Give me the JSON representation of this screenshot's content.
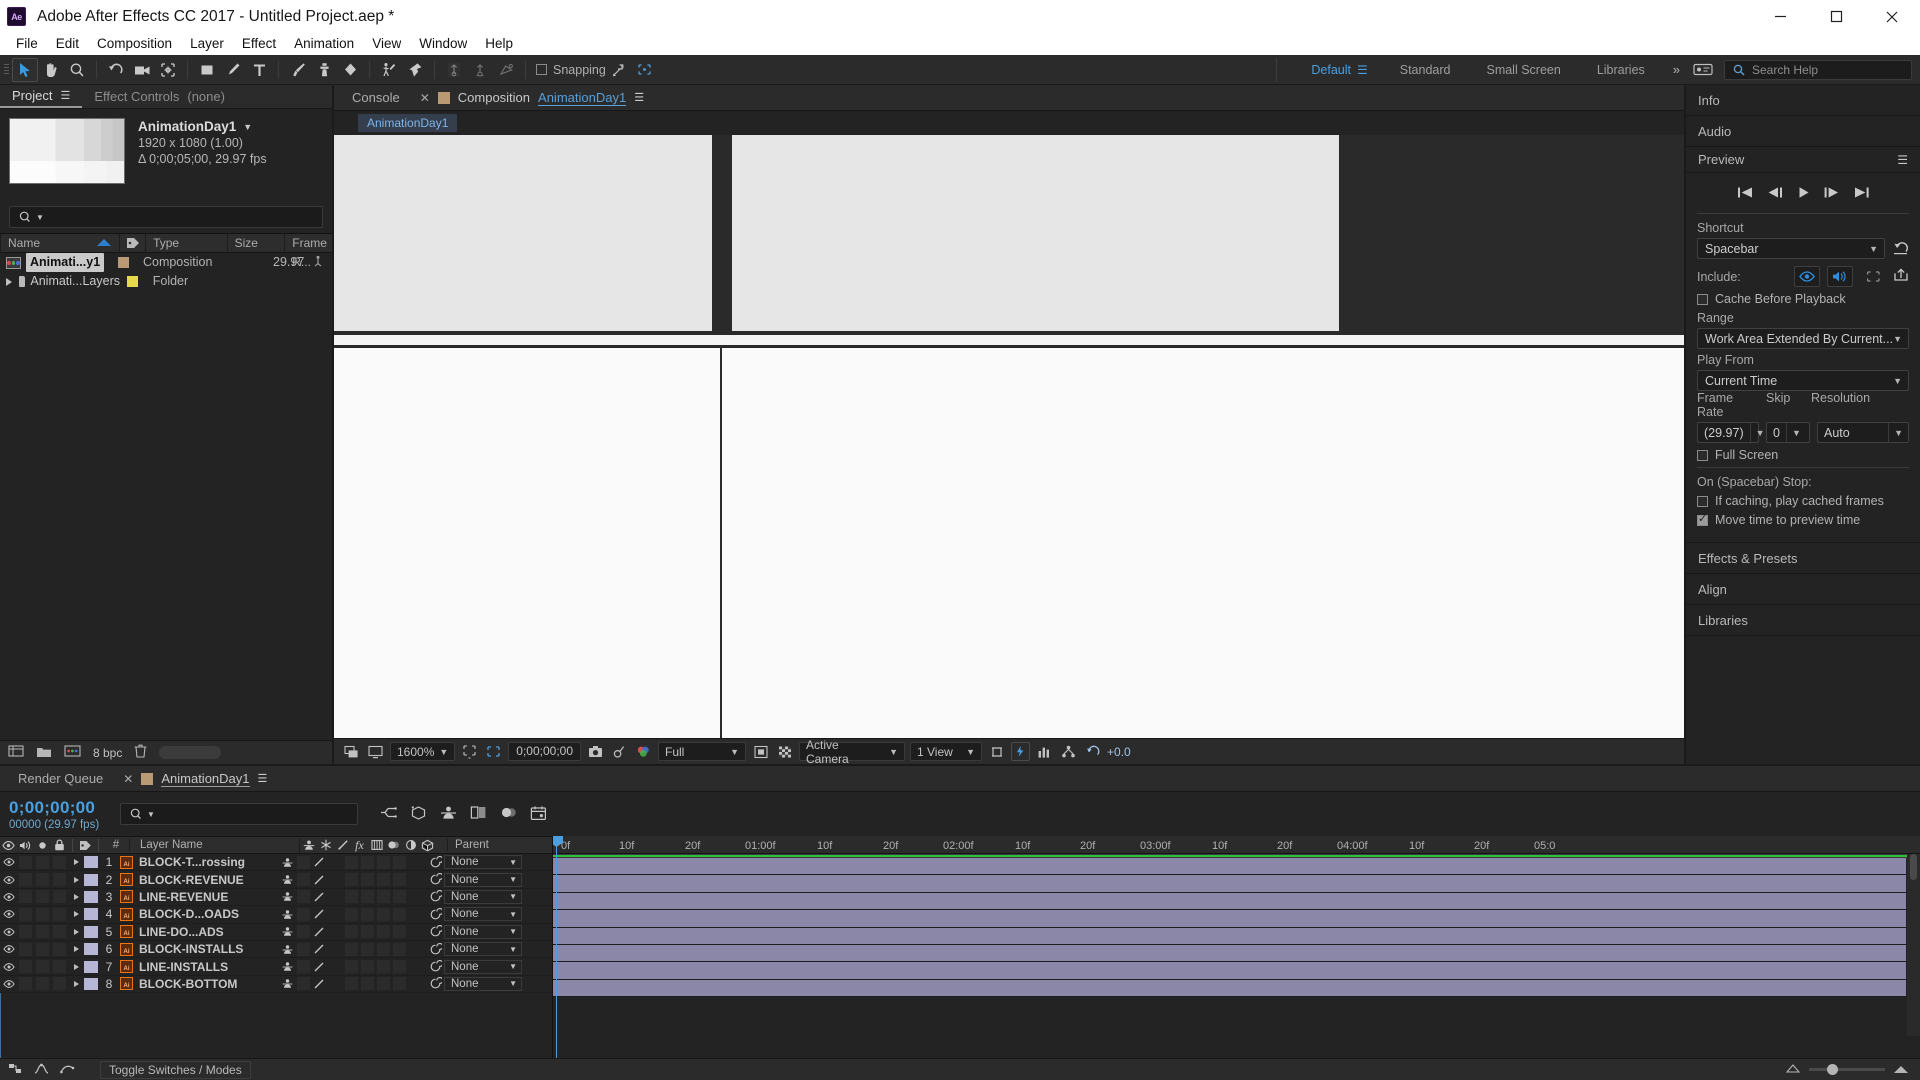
{
  "window": {
    "app_badge": "Ae",
    "title": "Adobe After Effects CC 2017 - Untitled Project.aep *",
    "controls": {
      "minimize": "—",
      "maximize": "❐",
      "close": "✕"
    }
  },
  "menubar": {
    "items": [
      "File",
      "Edit",
      "Composition",
      "Layer",
      "Effect",
      "Animation",
      "View",
      "Window",
      "Help"
    ]
  },
  "toolbar": {
    "snapping_label": "Snapping",
    "snapping_checked": false,
    "workspaces": [
      "Default",
      "Standard",
      "Small Screen",
      "Libraries"
    ],
    "workspace_selected": "Default",
    "overflow_label": "»",
    "search_help_placeholder": "Search Help",
    "search_help_value": "Search Help"
  },
  "project_panel": {
    "tabs": [
      {
        "label": "Project",
        "active": true,
        "has_menu": true
      },
      {
        "label": "Effect Controls",
        "suffix": "(none)",
        "active": false
      }
    ],
    "selected_item": {
      "name": "AnimationDay1",
      "dimensions": "1920 x 1080 (1.00)",
      "duration": "Δ 0;00;05;00, 29.97 fps"
    },
    "search_placeholder": "",
    "columns": [
      "Name",
      "",
      "Type",
      "Size",
      "Frame R..."
    ],
    "rows": [
      {
        "name": "Animati...y1",
        "type": "Composition",
        "size": "",
        "frame_rate": "29.97",
        "selected": true,
        "icon": "composition-icon",
        "swatch": "#b99a74",
        "expandable": false
      },
      {
        "name": "Animati...Layers",
        "type": "Folder",
        "size": "",
        "frame_rate": "",
        "selected": false,
        "icon": "folder-icon",
        "swatch": "#e3d94a",
        "expandable": true
      }
    ],
    "footer": {
      "bit_depth": "8 bpc"
    }
  },
  "composition_panel": {
    "tabs": [
      {
        "label": "Console",
        "active": false,
        "closable": true
      },
      {
        "label": "Composition",
        "link": "AnimationDay1",
        "active": true,
        "has_menu": true
      }
    ],
    "breadcrumb_chip": "AnimationDay1",
    "bottom_bar": {
      "zoom": "1600%",
      "timecode": "0;00;00;00",
      "quality": "Full",
      "camera": "Active Camera",
      "views": "1 View",
      "exposure": "+0.0"
    }
  },
  "right_panels": {
    "info": {
      "title": "Info"
    },
    "audio": {
      "title": "Audio"
    },
    "preview": {
      "title": "Preview",
      "shortcut_label": "Shortcut",
      "shortcut_value": "Spacebar",
      "include_label": "Include:",
      "cache_before_playback_label": "Cache Before Playback",
      "cache_before_playback_checked": false,
      "range_label": "Range",
      "range_value": "Work Area Extended By Current...",
      "play_from_label": "Play From",
      "play_from_value": "Current Time",
      "frame_rate_label": "Frame Rate",
      "frame_rate_value": "(29.97)",
      "skip_label": "Skip",
      "skip_value": "0",
      "resolution_label": "Resolution",
      "resolution_value": "Auto",
      "full_screen_label": "Full Screen",
      "full_screen_checked": false,
      "on_stop_label": "On (Spacebar) Stop:",
      "if_caching_label": "If caching, play cached frames",
      "if_caching_checked": false,
      "move_time_label": "Move time to preview time",
      "move_time_checked": true
    },
    "effects_presets": {
      "title": "Effects & Presets"
    },
    "align": {
      "title": "Align"
    },
    "libraries": {
      "title": "Libraries"
    }
  },
  "timeline": {
    "tabs": [
      {
        "label": "Render Queue",
        "active": false,
        "closable": true
      },
      {
        "label": "AnimationDay1",
        "active": true,
        "has_menu": true
      }
    ],
    "current_time": "0;00;00;00",
    "current_frame": "00000 (29.97 fps)",
    "search_placeholder": "",
    "columns": {
      "number": "#",
      "layer_name": "Layer Name",
      "parent": "Parent"
    },
    "ruler_ticks": [
      "0f",
      "10f",
      "20f",
      "01:00f",
      "10f",
      "20f",
      "02:00f",
      "10f",
      "20f",
      "03:00f",
      "10f",
      "20f",
      "04:00f",
      "10f",
      "20f",
      "05:0"
    ],
    "layers": [
      {
        "num": "1",
        "name": "BLOCK-T...rossing",
        "parent": "None",
        "visible": true,
        "source": "ai-icon"
      },
      {
        "num": "2",
        "name": "BLOCK-REVENUE",
        "parent": "None",
        "visible": true,
        "source": "ai-icon"
      },
      {
        "num": "3",
        "name": "LINE-REVENUE",
        "parent": "None",
        "visible": true,
        "source": "ai-icon"
      },
      {
        "num": "4",
        "name": "BLOCK-D...OADS",
        "parent": "None",
        "visible": true,
        "source": "ai-icon"
      },
      {
        "num": "5",
        "name": "LINE-DO...ADS",
        "parent": "None",
        "visible": true,
        "source": "ai-icon"
      },
      {
        "num": "6",
        "name": "BLOCK-INSTALLS",
        "parent": "None",
        "visible": true,
        "source": "ai-icon"
      },
      {
        "num": "7",
        "name": "LINE-INSTALLS",
        "parent": "None",
        "visible": true,
        "source": "ai-icon"
      },
      {
        "num": "8",
        "name": "BLOCK-BOTTOM",
        "parent": "None",
        "visible": true,
        "source": "ai-icon"
      }
    ],
    "footer": {
      "toggle_switches_modes": "Toggle Switches / Modes"
    }
  },
  "colors": {
    "accent_blue": "#4d9ede",
    "panel_bg": "#232323",
    "header_bg": "#2b2b2b",
    "track_purple": "#8a87a8",
    "work_area_green": "#2fbd3a",
    "label_lavender": "#b8b6d6"
  }
}
